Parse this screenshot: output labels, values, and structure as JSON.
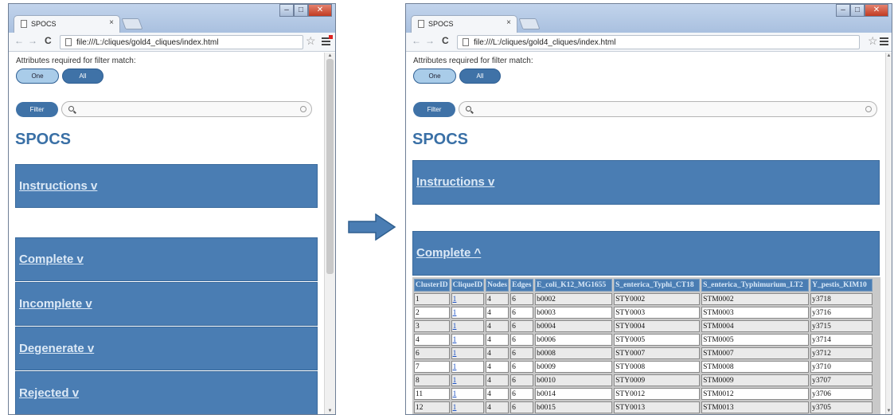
{
  "browser": {
    "tab_title": "SPOCS",
    "tab_close": "×",
    "url": "file:///L:/cliques/gold4_cliques/index.html"
  },
  "page": {
    "filter_label": "Attributes required for filter match:",
    "option_one": "One",
    "option_all": "All",
    "filter_button": "Filter",
    "search_placeholder": "",
    "title": "SPOCS"
  },
  "left_sections": [
    {
      "label": "Instructions v"
    },
    {
      "label": "Complete v"
    },
    {
      "label": "Incomplete v"
    },
    {
      "label": "Degenerate v"
    },
    {
      "label": "Rejected v"
    }
  ],
  "right_sections": [
    {
      "label": "Instructions v"
    },
    {
      "label": "Complete ^"
    }
  ],
  "table": {
    "headers": [
      "ClusterID",
      "CliqueID",
      "Nodes",
      "Edges",
      "E_coli_K12_MG1655",
      "S_enterica_Typhi_CT18",
      "S_enterica_Typhimurium_LT2",
      "Y_pestis_KIM10"
    ],
    "rows": [
      [
        "1",
        "1",
        "4",
        "6",
        "b0002",
        "STY0002",
        "STM0002",
        "y3718"
      ],
      [
        "2",
        "1",
        "4",
        "6",
        "b0003",
        "STY0003",
        "STM0003",
        "y3716"
      ],
      [
        "3",
        "1",
        "4",
        "6",
        "b0004",
        "STY0004",
        "STM0004",
        "y3715"
      ],
      [
        "4",
        "1",
        "4",
        "6",
        "b0006",
        "STY0005",
        "STM0005",
        "y3714"
      ],
      [
        "6",
        "1",
        "4",
        "6",
        "b0008",
        "STY0007",
        "STM0007",
        "y3712"
      ],
      [
        "7",
        "1",
        "4",
        "6",
        "b0009",
        "STY0008",
        "STM0008",
        "y3710"
      ],
      [
        "8",
        "1",
        "4",
        "6",
        "b0010",
        "STY0009",
        "STM0009",
        "y3707"
      ],
      [
        "11",
        "1",
        "4",
        "6",
        "b0014",
        "STY0012",
        "STM0012",
        "y3706"
      ],
      [
        "12",
        "1",
        "4",
        "6",
        "b0015",
        "STY0013",
        "STM0013",
        "y3705"
      ]
    ]
  },
  "colors": {
    "accent": "#4a7db3",
    "section_text": "#dce9f6",
    "link": "#1a4fc2"
  }
}
